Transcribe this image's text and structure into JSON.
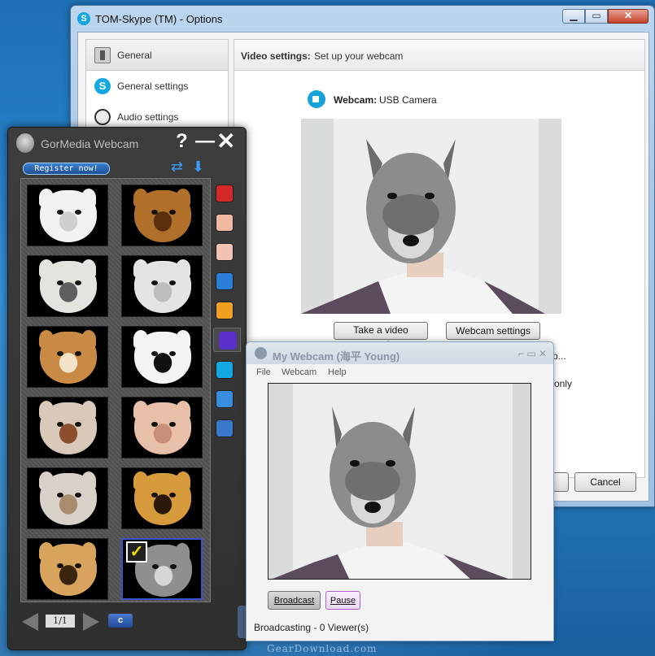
{
  "skype": {
    "title": "TOM-Skype (TM) - Options",
    "sidebar": [
      {
        "label": "General",
        "icon": "general-icon"
      },
      {
        "label": "General settings",
        "icon": "skype-icon"
      },
      {
        "label": "Audio settings",
        "icon": "audio-icon"
      }
    ],
    "header_bold": "Video settings:",
    "header_text": "Set up your webcam",
    "webcam_label": "Webcam:",
    "webcam_value": "USB Camera",
    "snapshot_button": "Take a video snapshot",
    "webcam_settings_button": "Webcam settings",
    "partial_text_1": "p...",
    "partial_text_2": "only",
    "cancel_button": "Cancel"
  },
  "gormedia": {
    "title": "GorMedia Webcam",
    "help": "?",
    "minimize": "—",
    "close": "✕",
    "register": "Register now!",
    "masks": [
      {
        "name": "polar-bear",
        "color": "#f2f2f2",
        "accent": "#cfcfcf"
      },
      {
        "name": "lion",
        "color": "#b0702a",
        "accent": "#5a2e0d"
      },
      {
        "name": "cat",
        "color": "#e5e3de",
        "accent": "#5f5f5f"
      },
      {
        "name": "monkey",
        "color": "#e4e4e4",
        "accent": "#bdbdbd"
      },
      {
        "name": "dog",
        "color": "#c98a45",
        "accent": "#f2e2c8"
      },
      {
        "name": "panda",
        "color": "#f3f3f3",
        "accent": "#111111"
      },
      {
        "name": "bulldog",
        "color": "#d8c9b8",
        "accent": "#8b4f2e"
      },
      {
        "name": "pig",
        "color": "#e8bfa9",
        "accent": "#c98f7a"
      },
      {
        "name": "goat",
        "color": "#d8d1c8",
        "accent": "#a78c6e"
      },
      {
        "name": "tiger",
        "color": "#d69a3c",
        "accent": "#2b1a0a"
      },
      {
        "name": "cheetah",
        "color": "#d8a35c",
        "accent": "#3a2410"
      },
      {
        "name": "wolf",
        "color": "#8f8f8f",
        "accent": "#d6d6d6"
      }
    ],
    "selected_mask": "wolf",
    "tools": [
      {
        "name": "effects-icon",
        "color": "#d42a2a"
      },
      {
        "name": "face-frame-icon",
        "color": "#f0b8a0"
      },
      {
        "name": "tv-frame-icon",
        "color": "#f2c2b4"
      },
      {
        "name": "contact-icon",
        "color": "#2c7fd6"
      },
      {
        "name": "mask-icon",
        "color": "#f0a020"
      },
      {
        "name": "chat-icon",
        "color": "#5b2fc9"
      },
      {
        "name": "skype-icon",
        "color": "#13a7e3"
      },
      {
        "name": "photo-icon",
        "color": "#3a8ee0"
      },
      {
        "name": "video-icon",
        "color": "#3a78c9"
      }
    ],
    "pager": "1/1",
    "pager_c": "c"
  },
  "mywebcam": {
    "title": "My Webcam (海平 Young)",
    "controls": "⌐ ▭ ✕",
    "menu": [
      "File",
      "Webcam",
      "Help"
    ],
    "broadcast_button": "Broadcast",
    "pause_button": "Pause",
    "status": "Broadcasting - 0 Viewer(s)"
  },
  "watermark": "GearDownload.com"
}
